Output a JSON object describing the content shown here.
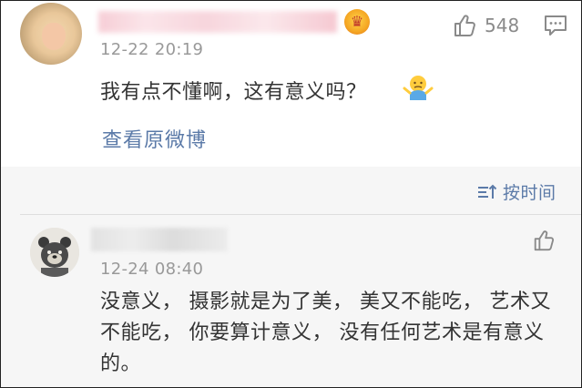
{
  "top_comment": {
    "timestamp": "12-22 20:19",
    "like_count": "548",
    "text": "我有点不懂啊，这有意义吗？",
    "view_original_link": "查看原微博"
  },
  "replies": {
    "sort_label": "按时间",
    "items": [
      {
        "timestamp": "12-24 08:40",
        "text": "没意义， 摄影就是为了美， 美又不能吃， 艺术又不能吃， 你要算计意义， 没有任何艺术是有意义的。"
      }
    ]
  },
  "colors": {
    "link_blue": "#5b7aa8",
    "timestamp_gray": "#999999",
    "reply_background": "#f6f6f6"
  },
  "icons": [
    "thumbs-up-icon",
    "reply-comment-icon",
    "crown-badge-icon",
    "shrug-emoji-icon",
    "sort-icon"
  ]
}
